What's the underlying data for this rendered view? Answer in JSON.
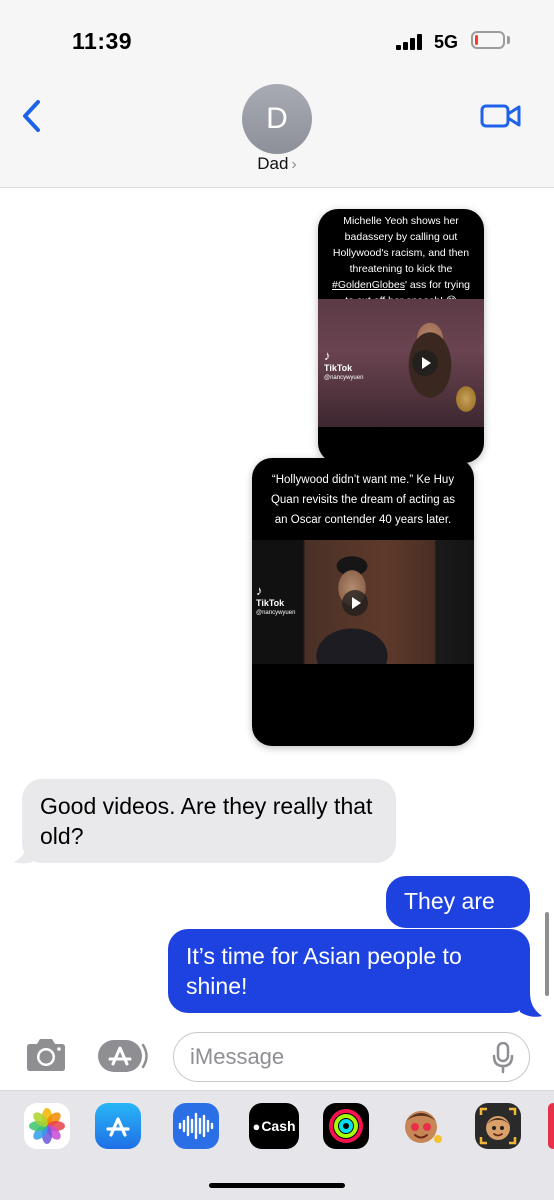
{
  "status_bar": {
    "time": "11:39",
    "network": "5G",
    "battery_level": 0.12,
    "battery_color": "#ff3b30"
  },
  "header": {
    "avatar_initial": "D",
    "contact_name": "Dad",
    "back_icon": "chevron-left-icon",
    "video_icon": "video-camera-icon",
    "accent_color": "#1e62e8"
  },
  "messages": {
    "cards": [
      {
        "caption": "Michelle Yeoh shows her badassery by calling out Hollywood's racism, and then threatening to kick the",
        "hashtag": "#GoldenGlobes",
        "caption_end": "' ass for trying to cut off her speech! 😅",
        "tiktok_label": "TikTok",
        "tiktok_handle": "@nancywyuen"
      },
      {
        "caption": "“Hollywood didn’t want me.” Ke Huy Quan revisits the dream of acting as an Oscar contender 40 years later.",
        "tiktok_label": "TikTok",
        "tiktok_handle": "@nancywyuen"
      }
    ],
    "received": [
      {
        "text": "Good videos. Are they really that old?"
      }
    ],
    "sent": [
      {
        "text": "They are"
      },
      {
        "text": "It’s time for Asian people to shine!"
      }
    ],
    "sent_color": "#1e42e0",
    "received_color": "#e9e9eb"
  },
  "input_bar": {
    "placeholder": "iMessage",
    "camera_icon": "camera-icon",
    "apps_icon": "app-store-icon",
    "mic_icon": "microphone-icon"
  },
  "app_drawer": {
    "apps": [
      {
        "icon": "photos-icon"
      },
      {
        "icon": "app-store-icon"
      },
      {
        "icon": "audio-message-icon"
      },
      {
        "icon": "apple-cash-icon",
        "label": "Cash"
      },
      {
        "icon": "activity-rings-icon"
      },
      {
        "icon": "memoji-stickers-icon"
      },
      {
        "icon": "memoji-icon"
      }
    ]
  }
}
